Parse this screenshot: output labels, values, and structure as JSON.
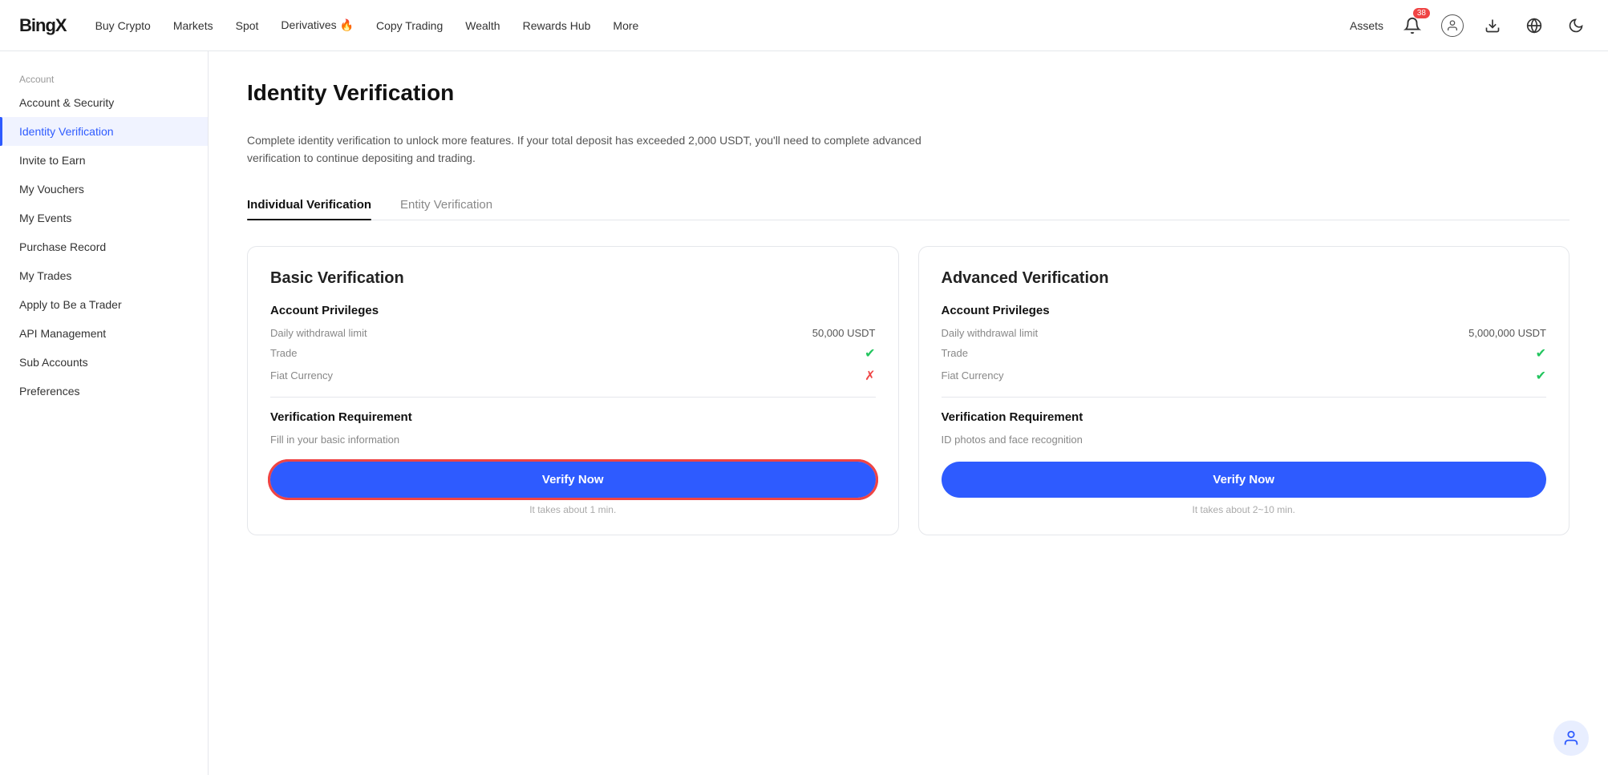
{
  "logo": "BingX",
  "nav": {
    "items": [
      {
        "label": "Buy Crypto",
        "id": "buy-crypto"
      },
      {
        "label": "Markets",
        "id": "markets"
      },
      {
        "label": "Spot",
        "id": "spot"
      },
      {
        "label": "Derivatives 🔥",
        "id": "derivatives",
        "fire": true
      },
      {
        "label": "Copy Trading",
        "id": "copy-trading"
      },
      {
        "label": "Wealth",
        "id": "wealth"
      },
      {
        "label": "Rewards Hub",
        "id": "rewards-hub"
      },
      {
        "label": "More",
        "id": "more"
      }
    ]
  },
  "header_right": {
    "assets_label": "Assets",
    "notification_badge": "38"
  },
  "sidebar": {
    "section_label": "Account",
    "items": [
      {
        "label": "Account & Security",
        "id": "account-security",
        "active": false
      },
      {
        "label": "Identity Verification",
        "id": "identity-verification",
        "active": true
      },
      {
        "label": "Invite to Earn",
        "id": "invite-to-earn",
        "active": false
      },
      {
        "label": "My Vouchers",
        "id": "my-vouchers",
        "active": false
      },
      {
        "label": "My Events",
        "id": "my-events",
        "active": false
      },
      {
        "label": "Purchase Record",
        "id": "purchase-record",
        "active": false
      },
      {
        "label": "My Trades",
        "id": "my-trades",
        "active": false
      },
      {
        "label": "Apply to Be a Trader",
        "id": "apply-trader",
        "active": false
      },
      {
        "label": "API Management",
        "id": "api-management",
        "active": false
      },
      {
        "label": "Sub Accounts",
        "id": "sub-accounts",
        "active": false
      },
      {
        "label": "Preferences",
        "id": "preferences",
        "active": false
      }
    ]
  },
  "main": {
    "page_title": "Identity Verification",
    "info_text": "Complete identity verification to unlock more features. If your total deposit has exceeded 2,000 USDT, you'll need to complete advanced verification to continue depositing and trading.",
    "tabs": [
      {
        "label": "Individual Verification",
        "active": true
      },
      {
        "label": "Entity Verification",
        "active": false
      }
    ],
    "cards": [
      {
        "title": "Basic Verification",
        "privileges_title": "Account Privileges",
        "privileges": [
          {
            "label": "Daily withdrawal limit",
            "value": "50,000 USDT",
            "icon": null
          },
          {
            "label": "Trade",
            "value": null,
            "icon": "check"
          },
          {
            "label": "Fiat Currency",
            "value": null,
            "icon": "cross"
          }
        ],
        "req_title": "Verification Requirement",
        "req_text": "Fill in your basic information",
        "btn_label": "Verify Now",
        "btn_highlighted": true,
        "time_note": "It takes about 1 min."
      },
      {
        "title": "Advanced Verification",
        "privileges_title": "Account Privileges",
        "privileges": [
          {
            "label": "Daily withdrawal limit",
            "value": "5,000,000 USDT",
            "icon": null
          },
          {
            "label": "Trade",
            "value": null,
            "icon": "check"
          },
          {
            "label": "Fiat Currency",
            "value": null,
            "icon": "check"
          }
        ],
        "req_title": "Verification Requirement",
        "req_text": "ID photos and face recognition",
        "btn_label": "Verify Now",
        "btn_highlighted": false,
        "time_note": "It takes about 2~10 min."
      }
    ]
  }
}
